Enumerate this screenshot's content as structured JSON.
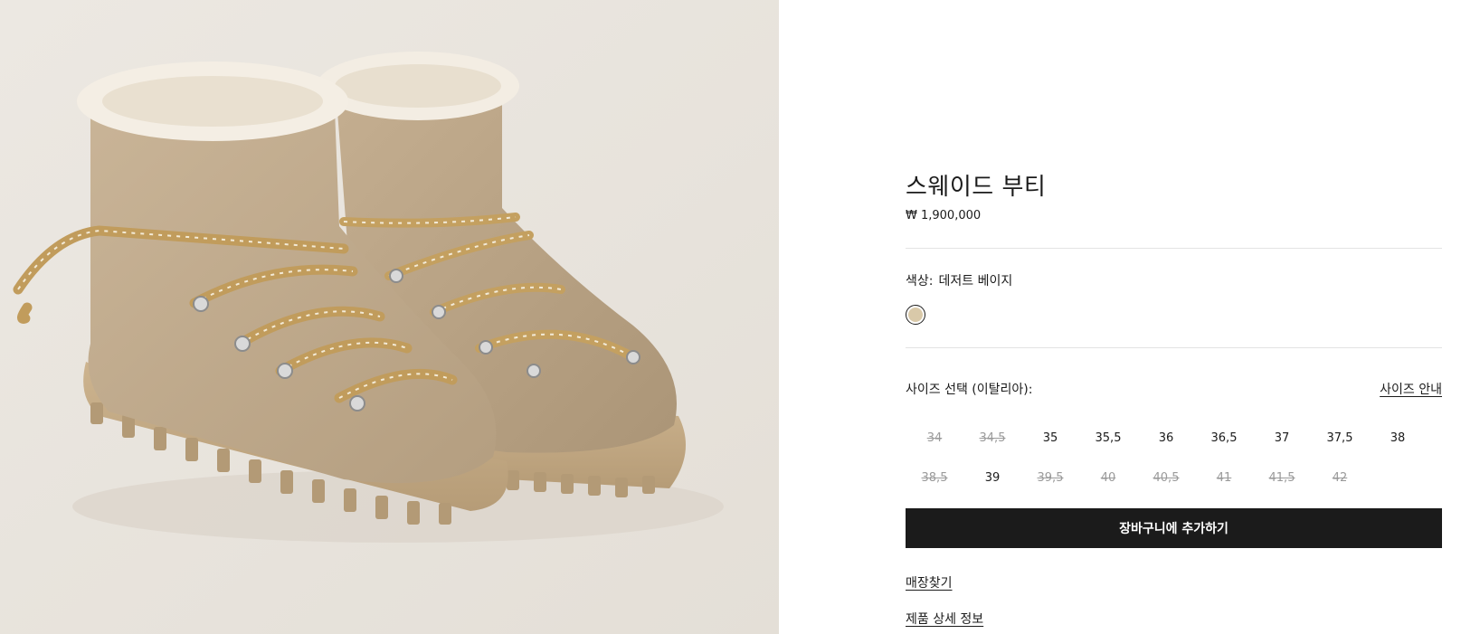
{
  "product": {
    "title": "스웨이드 부티",
    "price": "₩ 1,900,000"
  },
  "color": {
    "label": "색상:",
    "value": "데저트 베이지",
    "swatch_hex": "#d9c9a9"
  },
  "size": {
    "label": "사이즈 선택 (이탈리아):",
    "guide_link": "사이즈 안내",
    "rows": [
      [
        {
          "label": "34",
          "available": false
        },
        {
          "label": "34,5",
          "available": false
        },
        {
          "label": "35",
          "available": true
        },
        {
          "label": "35,5",
          "available": true
        },
        {
          "label": "36",
          "available": true
        },
        {
          "label": "36,5",
          "available": true
        },
        {
          "label": "37",
          "available": true
        },
        {
          "label": "37,5",
          "available": true
        },
        {
          "label": "38",
          "available": true
        }
      ],
      [
        {
          "label": "38,5",
          "available": false
        },
        {
          "label": "39",
          "available": true
        },
        {
          "label": "39,5",
          "available": false
        },
        {
          "label": "40",
          "available": false
        },
        {
          "label": "40,5",
          "available": false
        },
        {
          "label": "41",
          "available": false
        },
        {
          "label": "41,5",
          "available": false
        },
        {
          "label": "42",
          "available": false
        }
      ]
    ]
  },
  "cart_button": "장바구니에 추가하기",
  "links": {
    "store_finder": "매장찾기",
    "product_details": "제품 상세 정보"
  },
  "colors": {
    "image_background": "#e9e4dd",
    "button_background": "#1b1b1b",
    "unavailable_text": "#9a9a9a"
  }
}
